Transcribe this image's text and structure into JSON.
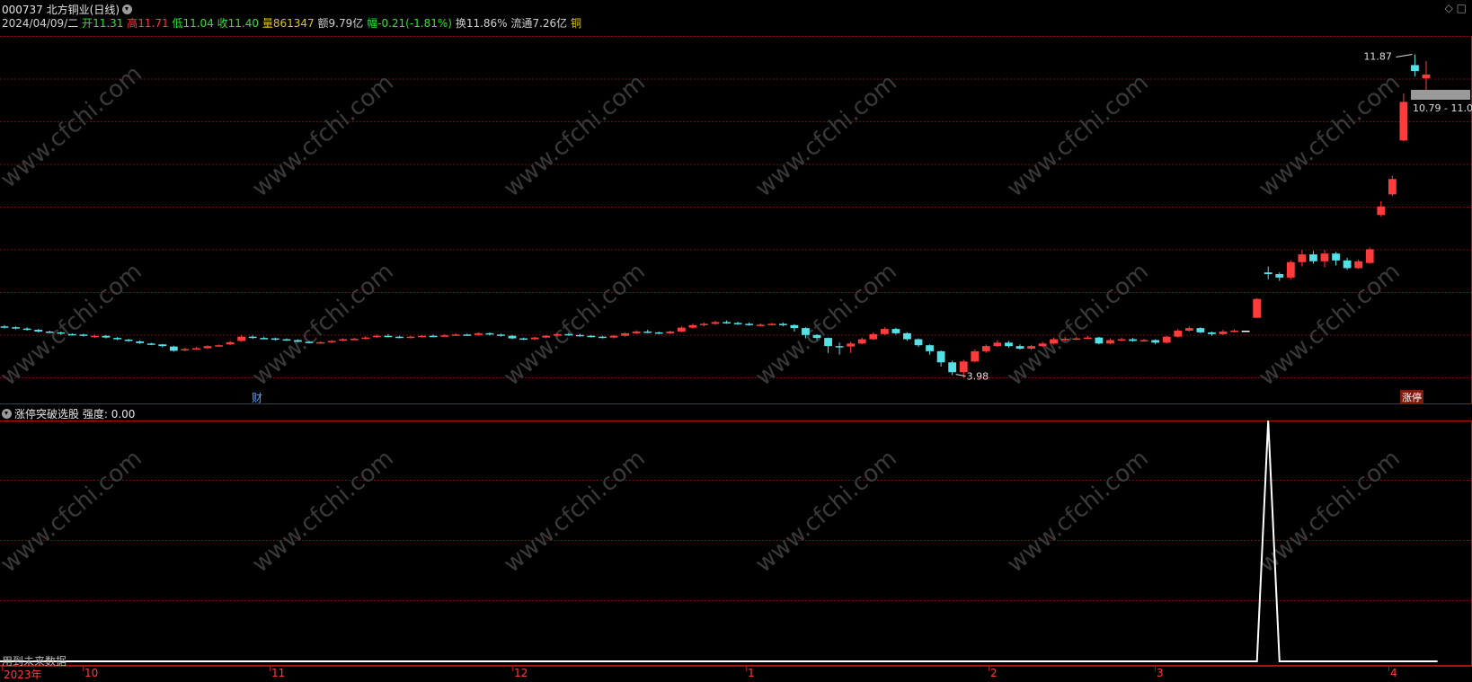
{
  "header": {
    "code": "000737",
    "name": "北方铜业",
    "period": "(日线)",
    "date": "2024/04/09/二",
    "open_label": "开",
    "open": "11.31",
    "high_label": "高",
    "high": "11.71",
    "low_label": "低",
    "low": "11.04",
    "close_label": "收",
    "close": "11.40",
    "volume_label": "量",
    "volume": "861347",
    "amount_label": "额",
    "amount": "9.79亿",
    "change_label": "幅",
    "change": "-0.21(-1.81%)",
    "turnover_label": "换",
    "turnover": "11.86%",
    "float_label": "流通",
    "float": "7.26亿",
    "sector": "铜"
  },
  "main_chart": {
    "high_marker": "11.87",
    "low_marker": "3.98",
    "price_band": "10.79 - 11.0",
    "finance_marker": "财",
    "limit_up_badge": "涨停",
    "watermark": "www.cfchi.com"
  },
  "indicator": {
    "name": "涨停突破选股",
    "strength_label": "强度:",
    "strength_value": "0.00",
    "future_data_note": "用到未来数据"
  },
  "time_axis": {
    "labels": [
      "2023年",
      "10",
      "11",
      "12",
      "1",
      "2",
      "3",
      "4"
    ]
  },
  "colors": {
    "up": "#ff3b3b",
    "down": "#54e0e6",
    "grid": "#7a0d0d",
    "indicator_line": "#ffffff"
  },
  "chart_data": {
    "type": "candlestick",
    "price_range": [
      3.98,
      11.87
    ],
    "indicator_values": [
      0,
      0,
      0,
      0,
      0,
      0,
      0,
      0,
      0,
      0,
      0,
      0,
      0,
      0,
      0,
      0,
      0,
      0,
      0,
      0,
      0,
      0,
      0,
      0,
      0,
      0,
      0,
      0,
      0,
      0,
      0,
      0,
      0,
      0,
      0,
      0,
      0,
      0,
      0,
      0,
      0,
      0,
      0,
      0,
      0,
      0,
      0,
      0,
      0,
      0,
      0,
      0,
      0,
      0,
      0,
      0,
      0,
      0,
      0,
      0,
      0,
      0,
      0,
      0,
      0,
      0,
      0,
      0,
      0,
      0,
      0,
      0,
      0,
      0,
      0,
      0,
      0,
      0,
      0,
      0,
      0,
      0,
      0,
      0,
      0,
      0,
      0,
      0,
      0,
      0,
      0,
      0,
      0,
      0,
      0,
      0,
      0,
      0,
      0,
      0,
      0,
      0,
      0,
      0,
      0,
      0,
      0,
      0,
      0,
      0,
      0,
      0,
      1,
      0,
      0,
      0,
      0,
      0,
      0,
      0,
      0,
      0,
      0,
      0,
      0,
      0,
      0,
      0
    ],
    "candles": [
      [
        5.52,
        5.5,
        5.55,
        5.47
      ],
      [
        5.5,
        5.48,
        5.52,
        5.45
      ],
      [
        5.47,
        5.45,
        5.5,
        5.42
      ],
      [
        5.44,
        5.4,
        5.46,
        5.38
      ],
      [
        5.4,
        5.38,
        5.42,
        5.36
      ],
      [
        5.38,
        5.35,
        5.4,
        5.32
      ],
      [
        5.34,
        5.33,
        5.36,
        5.31
      ],
      [
        5.33,
        5.3,
        5.35,
        5.28
      ],
      [
        5.28,
        5.3,
        5.33,
        5.25
      ],
      [
        5.3,
        5.26,
        5.32,
        5.24
      ],
      [
        5.25,
        5.22,
        5.27,
        5.2
      ],
      [
        5.21,
        5.18,
        5.23,
        5.16
      ],
      [
        5.17,
        5.13,
        5.19,
        5.11
      ],
      [
        5.12,
        5.1,
        5.14,
        5.08
      ],
      [
        5.1,
        5.06,
        5.11,
        5.03
      ],
      [
        5.05,
        4.95,
        5.07,
        4.93
      ],
      [
        4.96,
        4.99,
        5.02,
        4.94
      ],
      [
        5.0,
        5.01,
        5.04,
        4.98
      ],
      [
        5.01,
        5.06,
        5.08,
        4.99
      ],
      [
        5.07,
        5.08,
        5.1,
        5.05
      ],
      [
        5.1,
        5.15,
        5.18,
        5.08
      ],
      [
        5.18,
        5.28,
        5.32,
        5.16
      ],
      [
        5.28,
        5.25,
        5.31,
        5.23
      ],
      [
        5.25,
        5.24,
        5.28,
        5.22
      ],
      [
        5.24,
        5.22,
        5.26,
        5.19
      ],
      [
        5.22,
        5.2,
        5.24,
        5.18
      ],
      [
        5.2,
        5.16,
        5.22,
        5.15
      ],
      [
        5.16,
        5.14,
        5.18,
        5.12
      ],
      [
        5.14,
        5.15,
        5.17,
        5.12
      ],
      [
        5.15,
        5.18,
        5.2,
        5.13
      ],
      [
        5.19,
        5.22,
        5.24,
        5.17
      ],
      [
        5.22,
        5.23,
        5.25,
        5.2
      ],
      [
        5.23,
        5.26,
        5.29,
        5.21
      ],
      [
        5.27,
        5.3,
        5.33,
        5.25
      ],
      [
        5.3,
        5.29,
        5.34,
        5.27
      ],
      [
        5.28,
        5.26,
        5.3,
        5.24
      ],
      [
        5.26,
        5.28,
        5.3,
        5.24
      ],
      [
        5.28,
        5.3,
        5.32,
        5.26
      ],
      [
        5.3,
        5.29,
        5.33,
        5.27
      ],
      [
        5.29,
        5.31,
        5.34,
        5.28
      ],
      [
        5.31,
        5.33,
        5.36,
        5.3
      ],
      [
        5.33,
        5.32,
        5.35,
        5.31
      ],
      [
        5.32,
        5.36,
        5.38,
        5.3
      ],
      [
        5.36,
        5.33,
        5.38,
        5.31
      ],
      [
        5.33,
        5.3,
        5.35,
        5.28
      ],
      [
        5.3,
        5.24,
        5.32,
        5.22
      ],
      [
        5.24,
        5.22,
        5.26,
        5.2
      ],
      [
        5.22,
        5.26,
        5.28,
        5.2
      ],
      [
        5.26,
        5.3,
        5.32,
        5.24
      ],
      [
        5.3,
        5.34,
        5.36,
        5.28
      ],
      [
        5.34,
        5.32,
        5.37,
        5.3
      ],
      [
        5.32,
        5.3,
        5.35,
        5.28
      ],
      [
        5.3,
        5.28,
        5.32,
        5.26
      ],
      [
        5.28,
        5.26,
        5.3,
        5.24
      ],
      [
        5.26,
        5.3,
        5.32,
        5.24
      ],
      [
        5.3,
        5.36,
        5.38,
        5.28
      ],
      [
        5.36,
        5.4,
        5.43,
        5.34
      ],
      [
        5.4,
        5.38,
        5.44,
        5.36
      ],
      [
        5.38,
        5.36,
        5.4,
        5.34
      ],
      [
        5.36,
        5.4,
        5.42,
        5.34
      ],
      [
        5.4,
        5.49,
        5.52,
        5.38
      ],
      [
        5.49,
        5.55,
        5.58,
        5.47
      ],
      [
        5.55,
        5.58,
        5.61,
        5.52
      ],
      [
        5.58,
        5.62,
        5.65,
        5.56
      ],
      [
        5.62,
        5.6,
        5.66,
        5.58
      ],
      [
        5.6,
        5.58,
        5.63,
        5.56
      ],
      [
        5.58,
        5.55,
        5.61,
        5.53
      ],
      [
        5.55,
        5.56,
        5.59,
        5.52
      ],
      [
        5.56,
        5.58,
        5.6,
        5.54
      ],
      [
        5.58,
        5.55,
        5.61,
        5.52
      ],
      [
        5.55,
        5.48,
        5.57,
        5.4
      ],
      [
        5.48,
        5.32,
        5.5,
        5.24
      ],
      [
        5.32,
        5.25,
        5.34,
        5.2
      ],
      [
        5.25,
        5.06,
        5.26,
        4.9
      ],
      [
        5.06,
        5.05,
        5.14,
        4.86
      ],
      [
        5.05,
        5.12,
        5.16,
        4.9
      ],
      [
        5.12,
        5.22,
        5.26,
        5.1
      ],
      [
        5.22,
        5.34,
        5.38,
        5.2
      ],
      [
        5.34,
        5.46,
        5.5,
        5.32
      ],
      [
        5.46,
        5.36,
        5.49,
        5.33
      ],
      [
        5.36,
        5.22,
        5.38,
        5.18
      ],
      [
        5.22,
        5.08,
        5.24,
        5.04
      ],
      [
        5.08,
        4.94,
        5.1,
        4.86
      ],
      [
        4.94,
        4.68,
        4.96,
        4.58
      ],
      [
        4.68,
        4.45,
        4.72,
        4.38
      ],
      [
        4.45,
        4.7,
        4.74,
        4.32
      ],
      [
        4.7,
        4.94,
        4.98,
        4.68
      ],
      [
        4.94,
        5.06,
        5.1,
        4.9
      ],
      [
        5.06,
        5.14,
        5.2,
        5.04
      ],
      [
        5.14,
        5.06,
        5.18,
        5.02
      ],
      [
        5.06,
        5.0,
        5.1,
        4.98
      ],
      [
        5.0,
        5.06,
        5.09,
        4.97
      ],
      [
        5.06,
        5.12,
        5.16,
        5.04
      ],
      [
        5.12,
        5.22,
        5.26,
        5.1
      ],
      [
        5.22,
        5.23,
        5.28,
        5.18
      ],
      [
        5.23,
        5.24,
        5.28,
        5.2
      ],
      [
        5.24,
        5.26,
        5.3,
        5.22
      ],
      [
        5.26,
        5.12,
        5.28,
        5.1
      ],
      [
        5.12,
        5.2,
        5.24,
        5.1
      ],
      [
        5.2,
        5.22,
        5.25,
        5.18
      ],
      [
        5.22,
        5.18,
        5.25,
        5.16
      ],
      [
        5.18,
        5.2,
        5.23,
        5.16
      ],
      [
        5.2,
        5.14,
        5.22,
        5.1
      ],
      [
        5.14,
        5.28,
        5.3,
        5.12
      ],
      [
        5.28,
        5.42,
        5.46,
        5.26
      ],
      [
        5.42,
        5.48,
        5.52,
        5.4
      ],
      [
        5.48,
        5.38,
        5.5,
        5.36
      ],
      [
        5.38,
        5.34,
        5.4,
        5.3
      ],
      [
        5.34,
        5.4,
        5.44,
        5.32
      ],
      [
        5.4,
        5.42,
        5.45,
        5.38
      ],
      [
        5.42,
        5.42,
        5.42,
        5.42
      ],
      [
        5.72,
        6.16,
        6.18,
        5.72
      ],
      [
        6.78,
        6.74,
        6.92,
        6.62
      ],
      [
        6.74,
        6.66,
        6.78,
        6.58
      ],
      [
        6.66,
        7.02,
        7.06,
        6.62
      ],
      [
        7.02,
        7.2,
        7.3,
        6.92
      ],
      [
        7.2,
        7.04,
        7.28,
        6.98
      ],
      [
        7.04,
        7.22,
        7.3,
        6.9
      ],
      [
        7.22,
        7.06,
        7.26,
        6.94
      ],
      [
        7.06,
        6.88,
        7.12,
        6.84
      ],
      [
        6.88,
        7.04,
        7.08,
        6.86
      ],
      [
        7.0,
        7.32,
        7.36,
        6.98
      ],
      [
        8.12,
        8.32,
        8.44,
        8.08
      ],
      [
        8.6,
        8.96,
        9.04,
        8.56
      ],
      [
        9.86,
        10.76,
        10.96,
        9.84
      ],
      [
        11.62,
        11.48,
        11.87,
        11.36
      ],
      [
        11.31,
        11.4,
        11.71,
        11.04
      ]
    ]
  }
}
